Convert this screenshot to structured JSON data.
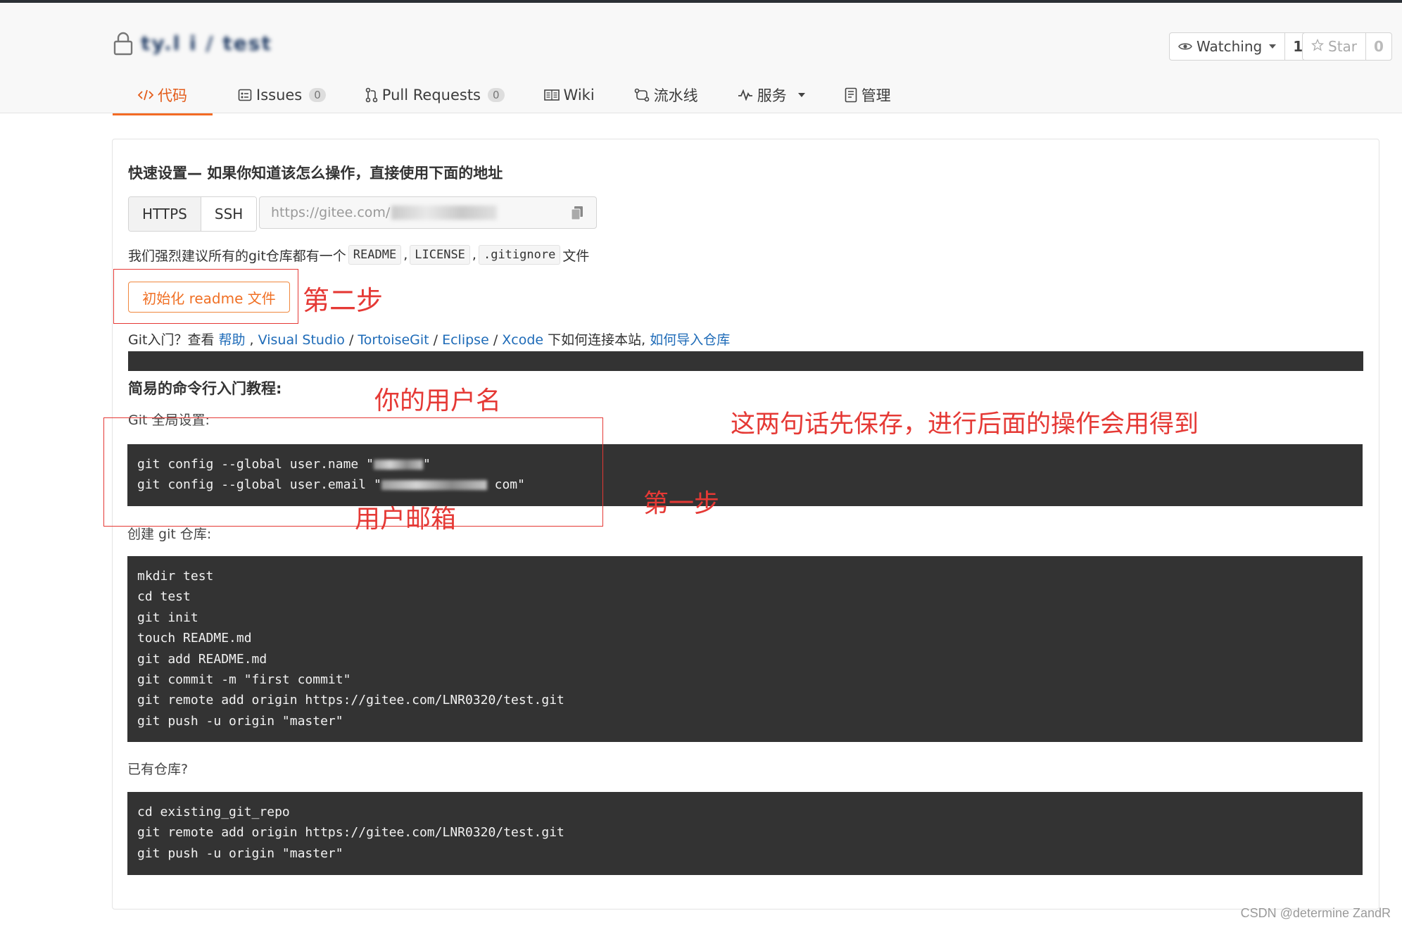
{
  "header": {
    "repo_name": "ty.l i / test",
    "watch": {
      "label": "Watching",
      "count": "1"
    },
    "star": {
      "label": "Star",
      "count": "0"
    }
  },
  "tabs": [
    {
      "label": "代码",
      "icon": "code-icon",
      "active": true
    },
    {
      "label": "Issues",
      "badge": "0",
      "icon": "issues-icon"
    },
    {
      "label": "Pull Requests",
      "badge": "0",
      "icon": "pull-request-icon"
    },
    {
      "label": "Wiki",
      "icon": "book-icon"
    },
    {
      "label": "流水线",
      "icon": "pipeline-icon"
    },
    {
      "label": "服务",
      "icon": "pulse-icon",
      "has_dropdown": true
    },
    {
      "label": "管理",
      "icon": "settings-doc-icon"
    }
  ],
  "quick_setup": {
    "title": "快速设置— 如果你知道该怎么操作，直接使用下面的地址",
    "protocols": [
      "HTTPS",
      "SSH"
    ],
    "url_prefix": "https://gitee.com/",
    "recommend_prefix": "我们强烈建议所有的git仓库都有一个",
    "files": [
      "README",
      "LICENSE",
      ".gitignore"
    ],
    "separator": ",",
    "recommend_suffix": "文件",
    "init_button": "初始化 readme 文件",
    "help_prefix": "Git入门？查看",
    "help_links": [
      "帮助",
      "Visual Studio",
      "TortoiseGit",
      "Eclipse",
      "Xcode"
    ],
    "help_mid": "下如何连接本站,",
    "import_link": "如何导入仓库"
  },
  "tutorial": {
    "title": "简易的命令行入门教程:",
    "global_label": "Git 全局设置:",
    "global_cmd1": "git config --global user.name \"",
    "global_cmd1_end": "\"",
    "global_cmd2": "git config --global user.email \"",
    "global_cmd2_end": "com\"",
    "create_label": "创建 git 仓库:",
    "create_cmds": [
      "mkdir test",
      "cd test",
      "git init",
      "touch README.md",
      "git add README.md",
      "git commit -m \"first commit\"",
      "git remote add origin https://gitee.com/LNR0320/test.git",
      "git push -u origin \"master\""
    ],
    "existing_label": "已有仓库?",
    "existing_cmds": [
      "cd existing_git_repo",
      "git remote add origin https://gitee.com/LNR0320/test.git",
      "git push -u origin \"master\""
    ]
  },
  "annotations": {
    "step2": "第二步",
    "username": "你的用户名",
    "save_note": "这两句话先保存，进行后面的操作会用得到",
    "step1": "第一步",
    "email": "用户邮箱"
  },
  "watermark": "CSDN @determine  ZandR",
  "colors": {
    "accent": "#f36b24",
    "link": "#1e6bb8",
    "annotation": "#e53935",
    "code_bg": "#333333"
  }
}
